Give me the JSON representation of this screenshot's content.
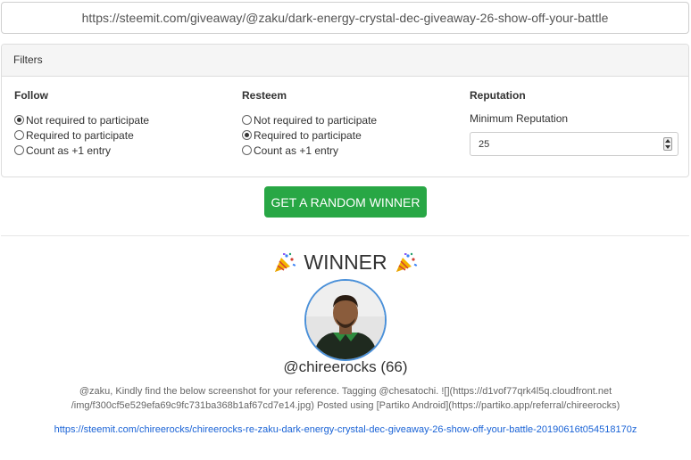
{
  "url_bar": {
    "value": "https://steemit.com/giveaway/@zaku/dark-energy-crystal-dec-giveaway-26-show-off-your-battle"
  },
  "filters": {
    "header": "Filters",
    "follow": {
      "title": "Follow",
      "options": [
        "Not required to participate",
        "Required to participate",
        "Count as +1 entry"
      ],
      "selected": "Not required to participate"
    },
    "resteem": {
      "title": "Resteem",
      "options": [
        "Not required to participate",
        "Required to participate",
        "Count as +1 entry"
      ],
      "selected": "Required to participate"
    },
    "reputation": {
      "title": "Reputation",
      "label": "Minimum Reputation",
      "value": "25"
    }
  },
  "button": {
    "label": "GET A RANDOM WINNER",
    "color": "#28a745"
  },
  "winner": {
    "title": "WINNER",
    "icon": "party-popper-icon",
    "username": "@chireerocks (66)",
    "comment": "@zaku, Kindly find the below screenshot for your reference. Tagging @chesatochi. ![](https://d1vof77qrk4l5q.cloudfront.net /img/f300cf5e529efa69c9fc731ba368b1af67cd7e14.jpg) Posted using [Partiko Android](https://partiko.app/referral/chireerocks)",
    "link": "https://steemit.com/chireerocks/chireerocks-re-zaku-dark-energy-crystal-dec-giveaway-26-show-off-your-battle-20190616t054518170z",
    "avatar_border_color": "#4a90d9",
    "link_color": "#1a63d6"
  }
}
